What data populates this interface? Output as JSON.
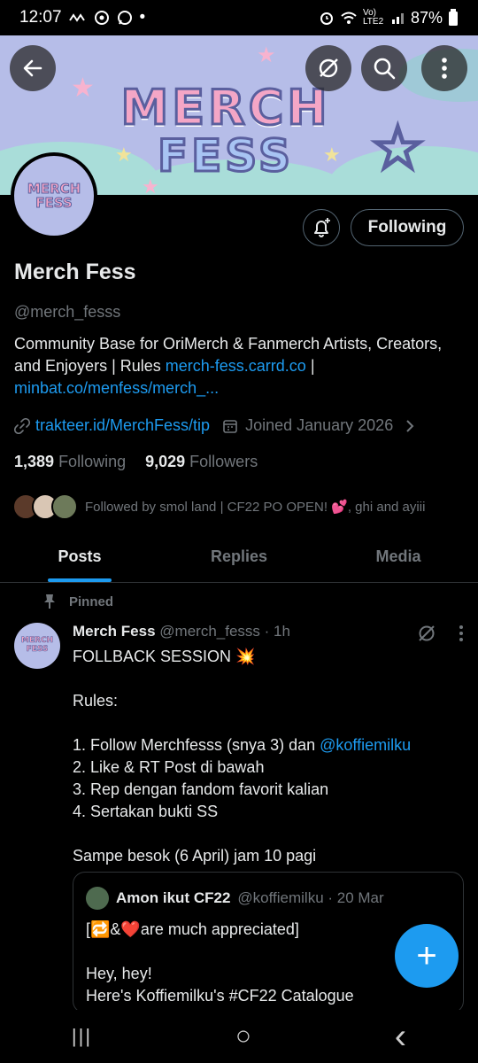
{
  "status": {
    "time": "12:07",
    "left_icons": [
      "signal-wave-icon",
      "target-icon",
      "message-icon",
      "dot"
    ],
    "dot": "•",
    "network": "Vo) LTE2",
    "battery": "87%"
  },
  "banner": {
    "logo_line1": "MERCH",
    "logo_line2": "FESS",
    "colors": {
      "background": "#b6bde8",
      "pink": "#f4a6c6",
      "outline": "#5a5f9e",
      "mint": "#a9ddd9"
    }
  },
  "profile": {
    "avatar_text_line1": "MERCH",
    "avatar_text_line2": "FESS",
    "following_button": "Following",
    "name": "Merch Fess",
    "handle": "@merch_fesss",
    "bio_text": "Community Base for OriMerch & Fanmerch Artists, Creators, and Enjoyers | Rules ",
    "bio_link1": "merch-fess.carrd.co",
    "bio_separator": " |",
    "bio_link2": "minbat.co/menfess/merch_...",
    "website": "trakteer.id/MerchFess/tip",
    "joined": "Joined January 2026",
    "following_count": "1,389",
    "following_label": "Following",
    "followers_count": "9,029",
    "followers_label": "Followers",
    "followed_by": "Followed by smol land | CF22 PO OPEN! 💕, ghi and ayiii"
  },
  "tabs": [
    {
      "label": "Posts",
      "active": true
    },
    {
      "label": "Replies",
      "active": false
    },
    {
      "label": "Media",
      "active": false
    }
  ],
  "post": {
    "pinned_label": "Pinned",
    "avatar_text_line1": "MERCH",
    "avatar_text_line2": "FESS",
    "author_name": "Merch Fess",
    "author_meta": "@merch_fesss · 1h",
    "body_line1": "FOLLBACK SESSION 💥",
    "body_line2": "Rules:",
    "rule1_text": "1. Follow Merchfesss (snya 3) dan ",
    "rule1_mention": "@koffiemilku",
    "rule2": "2. Like & RT Post di bawah",
    "rule3": "3. Rep dengan fandom favorit kalian",
    "rule4": "4. Sertakan bukti SS",
    "closing": "Sampe besok (6 April) jam 10 pagi"
  },
  "quote": {
    "author_name": "Amon ikut CF22",
    "author_meta": "@koffiemilku · 20 Mar",
    "line1": "[🔁&❤️are much appreciated]",
    "line2": "Hey, hey!",
    "line3": "Here's Koffiemilku's #CF22 Catalogue"
  },
  "fab": {
    "label": "+"
  },
  "navbar": {
    "recent": "|||",
    "home": "○",
    "back": "‹"
  },
  "colors": {
    "accent": "#1d9bf0",
    "text": "#e7e9ea",
    "muted": "#71767b",
    "border": "#2f3336"
  }
}
